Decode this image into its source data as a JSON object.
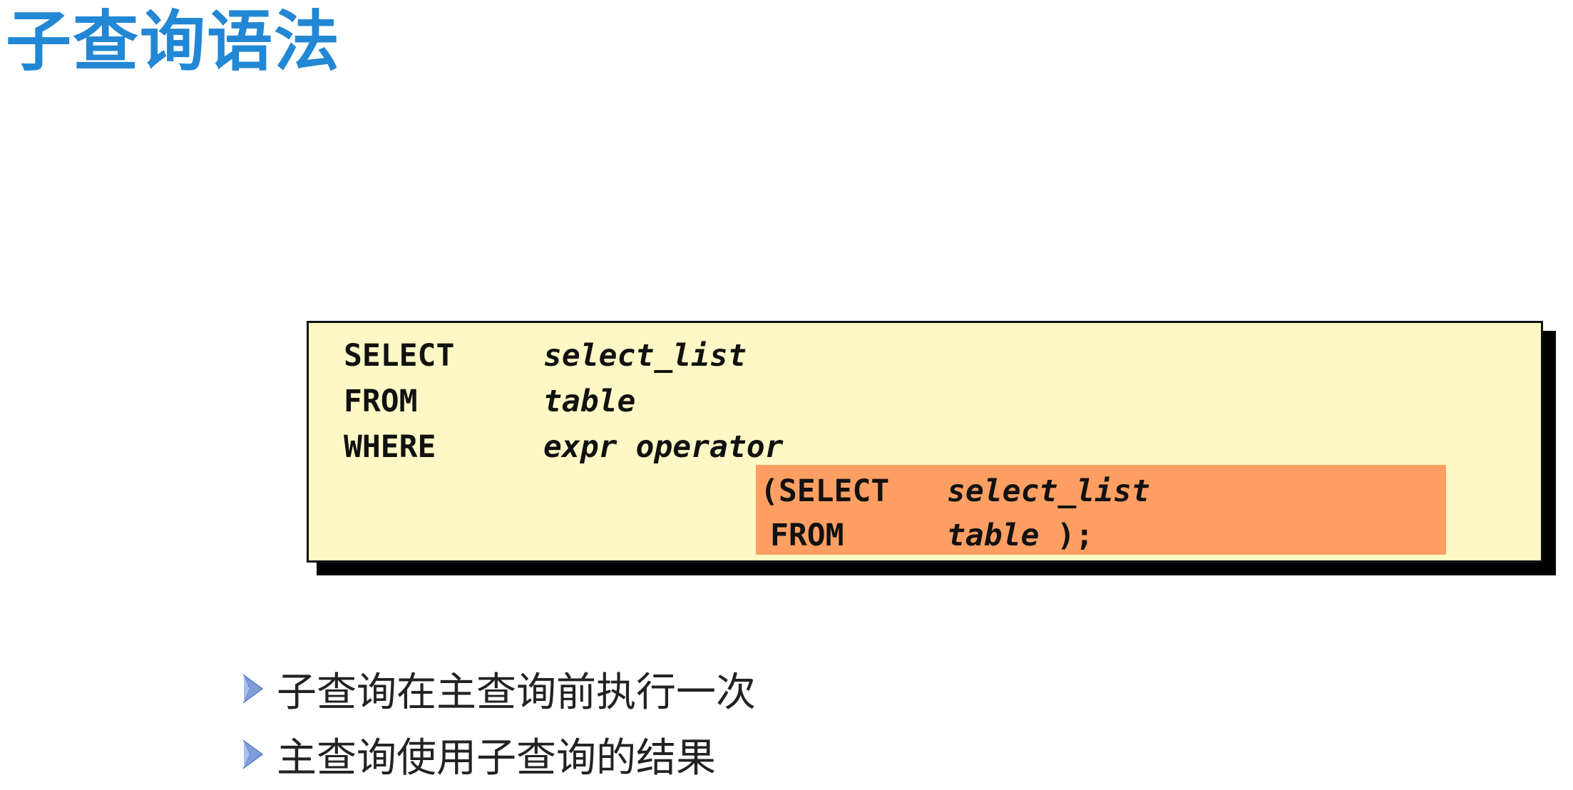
{
  "title": "子查询语法",
  "syntax": {
    "line1_keyword": "SELECT",
    "line1_value": "select_list",
    "line2_keyword": "FROM",
    "line2_value": "table",
    "line3_keyword": "WHERE",
    "line3_value": "expr operator",
    "sub_line1_keyword": "(SELECT",
    "sub_line1_value": "select_list",
    "sub_line2_keyword": "FROM",
    "sub_line2_value": "table",
    "sub_line2_end": ");",
    "colors": {
      "box_background": "#fdf8c5",
      "highlight_background": "#fd9f63",
      "shadow": "#000000"
    }
  },
  "bullets": [
    {
      "icon": "arrow-bullet-icon",
      "text": "子查询在主查询前执行一次"
    },
    {
      "icon": "arrow-bullet-icon",
      "text": "主查询使用子查询的结果"
    }
  ],
  "colors": {
    "title": "#2287d4",
    "bullet_arrow": "#7f9ed9"
  }
}
